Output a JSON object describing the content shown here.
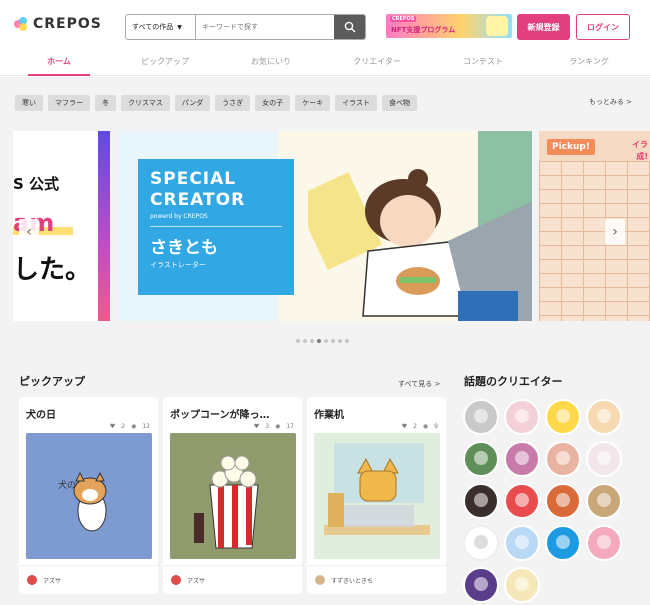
{
  "header": {
    "logo_text": "CREPOS",
    "search_category": "すべての作品",
    "search_placeholder": "キーワードで探す",
    "promo_small": "CREPOS",
    "promo_text": "NFT支援プログラム",
    "signup_label": "新規登録",
    "login_label": "ログイン"
  },
  "nav": {
    "tabs": [
      {
        "label": "ホーム",
        "active": true
      },
      {
        "label": "ピックアップ",
        "active": false
      },
      {
        "label": "お気にいり",
        "active": false
      },
      {
        "label": "クリエイター",
        "active": false
      },
      {
        "label": "コンテスト",
        "active": false
      },
      {
        "label": "ランキング",
        "active": false
      }
    ]
  },
  "tags": [
    "寒い",
    "マフラー",
    "冬",
    "クリスマス",
    "パンダ",
    "うさぎ",
    "女の子",
    "ケーキ",
    "イラスト",
    "食べ物"
  ],
  "tags_more": "もっとみる >",
  "carousel": {
    "left_slide": {
      "line1": "S 公式",
      "line2": "am",
      "line3": "した。"
    },
    "main_slide": {
      "line1": "SPECIAL",
      "line2": "CREATOR",
      "powered": "powerd by CREPOS",
      "name": "さきとも",
      "role": "イラストレーター"
    },
    "right_slide": {
      "badge": "Pickup!",
      "side_text_1": "イラ",
      "side_text_2": "成!"
    },
    "prev_arrow": "‹",
    "next_arrow": "›",
    "dot_count": 8,
    "active_dot": 3
  },
  "pickup": {
    "title": "ピックアップ",
    "see_all": "すべて見る >",
    "cards": [
      {
        "title": "犬の日",
        "likes": "2",
        "views": "12",
        "author": "アズサ"
      },
      {
        "title": "ポップコーンが降っ…",
        "likes": "3",
        "views": "17",
        "author": "アズサ"
      },
      {
        "title": "作業机",
        "likes": "2",
        "views": "9",
        "author": "すずきいときち"
      }
    ]
  },
  "creators": {
    "title": "話題のクリエイター",
    "avatar_colors": [
      "#c9c9c9",
      "#f3d0d6",
      "#ffd94a",
      "#f6d9b0",
      "#5f8f59",
      "#c87aa8",
      "#e8b3a0",
      "#f2e6ea",
      "#3a2f2c",
      "#e94c4c",
      "#d96b3b",
      "#caa779",
      "#ffffff",
      "#b8d8f5",
      "#1d9be2",
      "#f4a9bd",
      "#5a3d8a",
      "#f6e7b8"
    ]
  },
  "colors": {
    "accent": "#e23f7e",
    "special_blue": "#31a7e4"
  }
}
